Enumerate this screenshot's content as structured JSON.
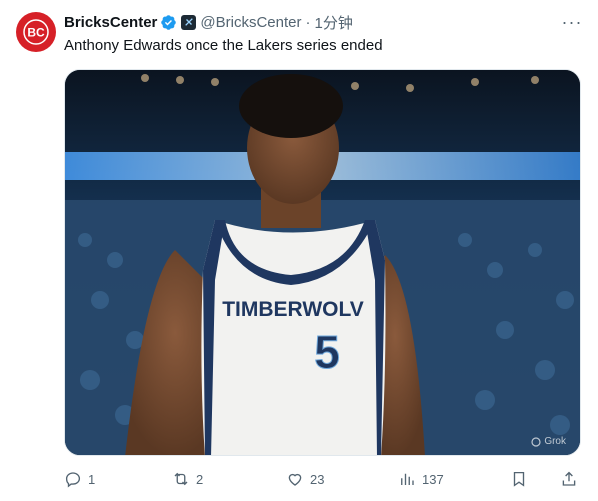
{
  "tweet": {
    "display_name": "BricksCenter",
    "handle": "@BricksCenter",
    "separator": "·",
    "time": "1分钟",
    "text": "Anthony Edwards once the Lakers series ended",
    "avatar_text": "BC"
  },
  "media": {
    "jersey_team": "TIMBERWOLV",
    "jersey_number": "5",
    "watermark": "Grok"
  },
  "actions": {
    "reply_count": "1",
    "repost_count": "2",
    "like_count": "23",
    "views_count": "137"
  },
  "colors": {
    "brand_red": "#d62027",
    "verified_blue": "#1d9bf0",
    "muted": "#536471"
  }
}
